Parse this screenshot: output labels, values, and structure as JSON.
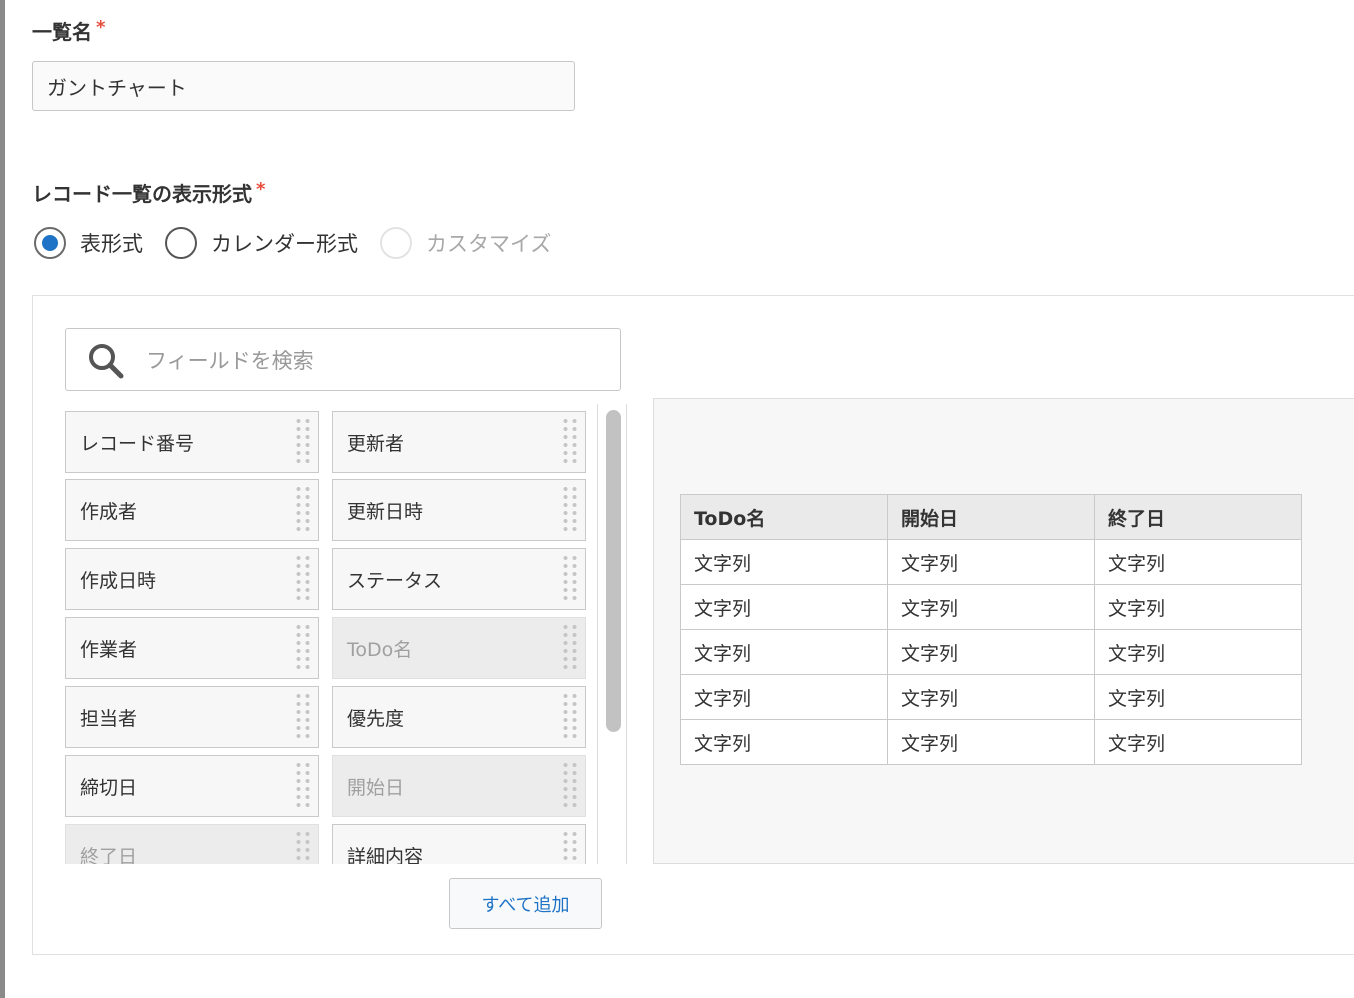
{
  "list_name": {
    "label": "一覧名",
    "required_mark": "*",
    "value": "ガントチャート"
  },
  "display_format": {
    "label": "レコード一覧の表示形式",
    "required_mark": "*",
    "options": [
      {
        "label": "表形式",
        "selected": true,
        "disabled": false
      },
      {
        "label": "カレンダー形式",
        "selected": false,
        "disabled": false
      },
      {
        "label": "カスタマイズ",
        "selected": false,
        "disabled": true
      }
    ]
  },
  "field_search": {
    "placeholder": "フィールドを検索",
    "icon": "search-icon"
  },
  "fields": [
    {
      "label": "レコード番号",
      "used": false
    },
    {
      "label": "更新者",
      "used": false
    },
    {
      "label": "作成者",
      "used": false
    },
    {
      "label": "更新日時",
      "used": false
    },
    {
      "label": "作成日時",
      "used": false
    },
    {
      "label": "ステータス",
      "used": false
    },
    {
      "label": "作業者",
      "used": false
    },
    {
      "label": "ToDo名",
      "used": true
    },
    {
      "label": "担当者",
      "used": false
    },
    {
      "label": "優先度",
      "used": false
    },
    {
      "label": "締切日",
      "used": false
    },
    {
      "label": "開始日",
      "used": true
    },
    {
      "label": "終了日",
      "used": true
    },
    {
      "label": "詳細内容",
      "used": false
    }
  ],
  "add_all_label": "すべて追加",
  "preview": {
    "columns": [
      "ToDo名",
      "開始日",
      "終了日"
    ],
    "rows": [
      [
        "文字列",
        "文字列",
        "文字列"
      ],
      [
        "文字列",
        "文字列",
        "文字列"
      ],
      [
        "文字列",
        "文字列",
        "文字列"
      ],
      [
        "文字列",
        "文字列",
        "文字列"
      ],
      [
        "文字列",
        "文字列",
        "文字列"
      ]
    ]
  },
  "colors": {
    "accent": "#1e73c6",
    "required": "#e74c3c"
  }
}
